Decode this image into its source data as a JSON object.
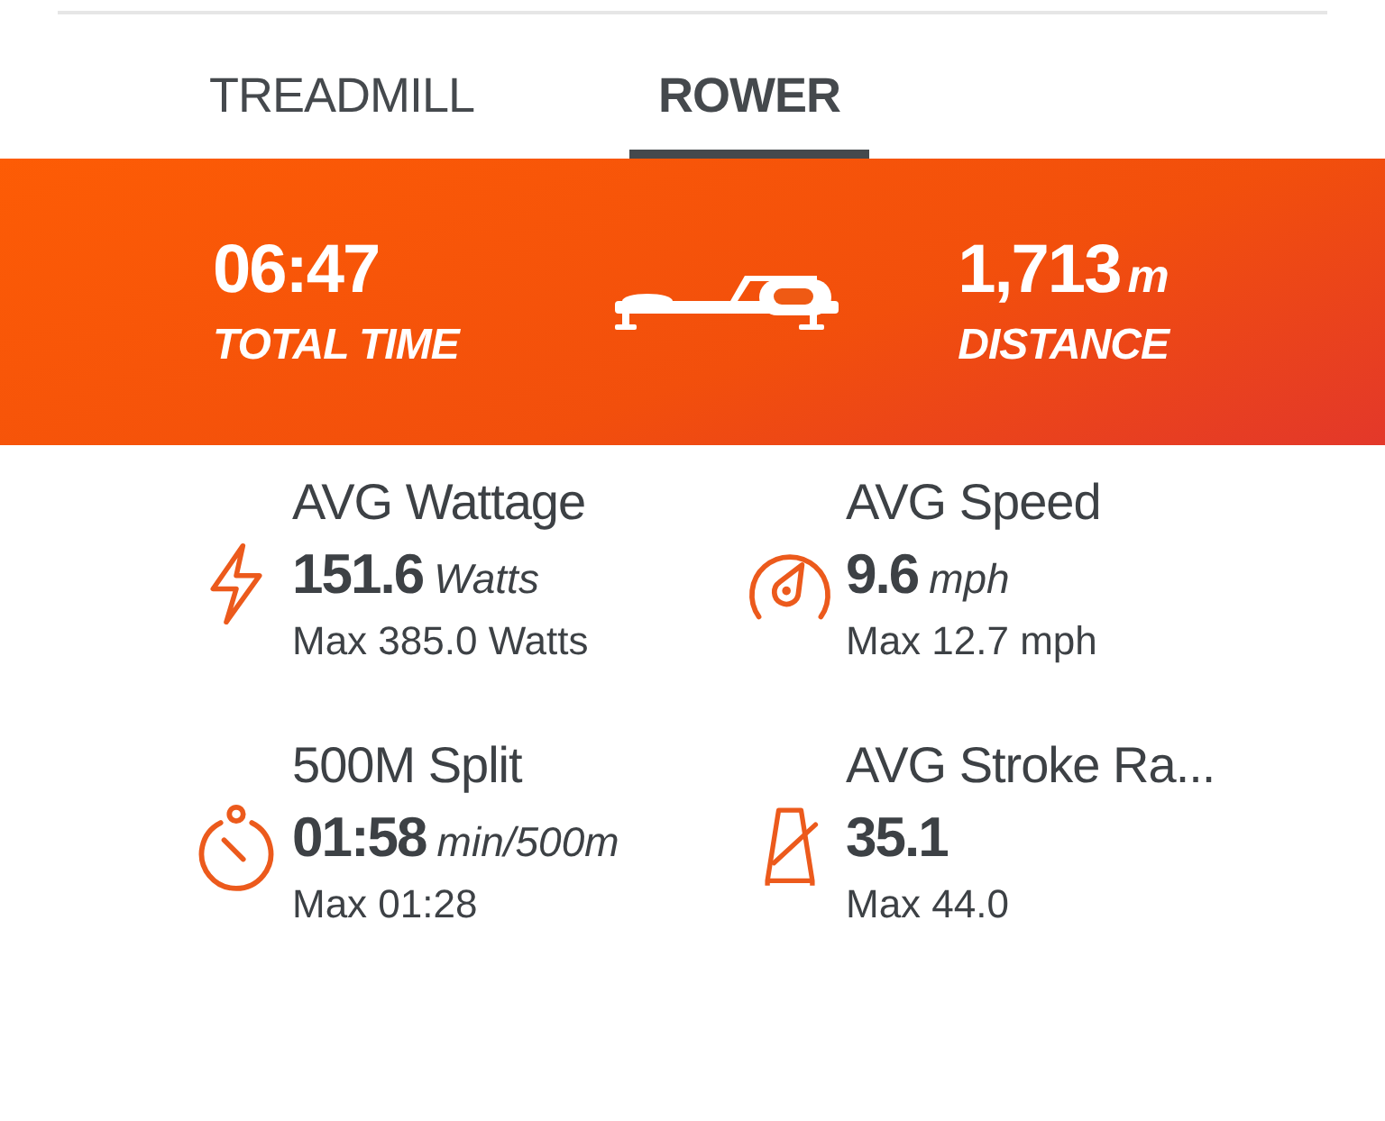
{
  "tabs": [
    {
      "label": "TREADMILL",
      "selected": false
    },
    {
      "label": "ROWER",
      "selected": true
    }
  ],
  "summary": {
    "time": {
      "value": "06:47",
      "label": "TOTAL TIME"
    },
    "distance": {
      "value": "1,713",
      "unit": "m",
      "label": "DISTANCE"
    }
  },
  "metrics": [
    {
      "kind": "power",
      "title": "AVG Wattage",
      "value": "151.6",
      "unit": "Watts",
      "max": "Max 385.0 Watts"
    },
    {
      "kind": "speed",
      "title": "AVG Speed",
      "value": "9.6",
      "unit": "mph",
      "max": "Max 12.7 mph"
    },
    {
      "kind": "split",
      "title": "500M Split",
      "value": "01:58",
      "unit": "min/500m",
      "max": "Max 01:28"
    },
    {
      "kind": "stroke",
      "title": "AVG Stroke Ra...",
      "value": "35.1",
      "max": "Max 44.0"
    }
  ]
}
